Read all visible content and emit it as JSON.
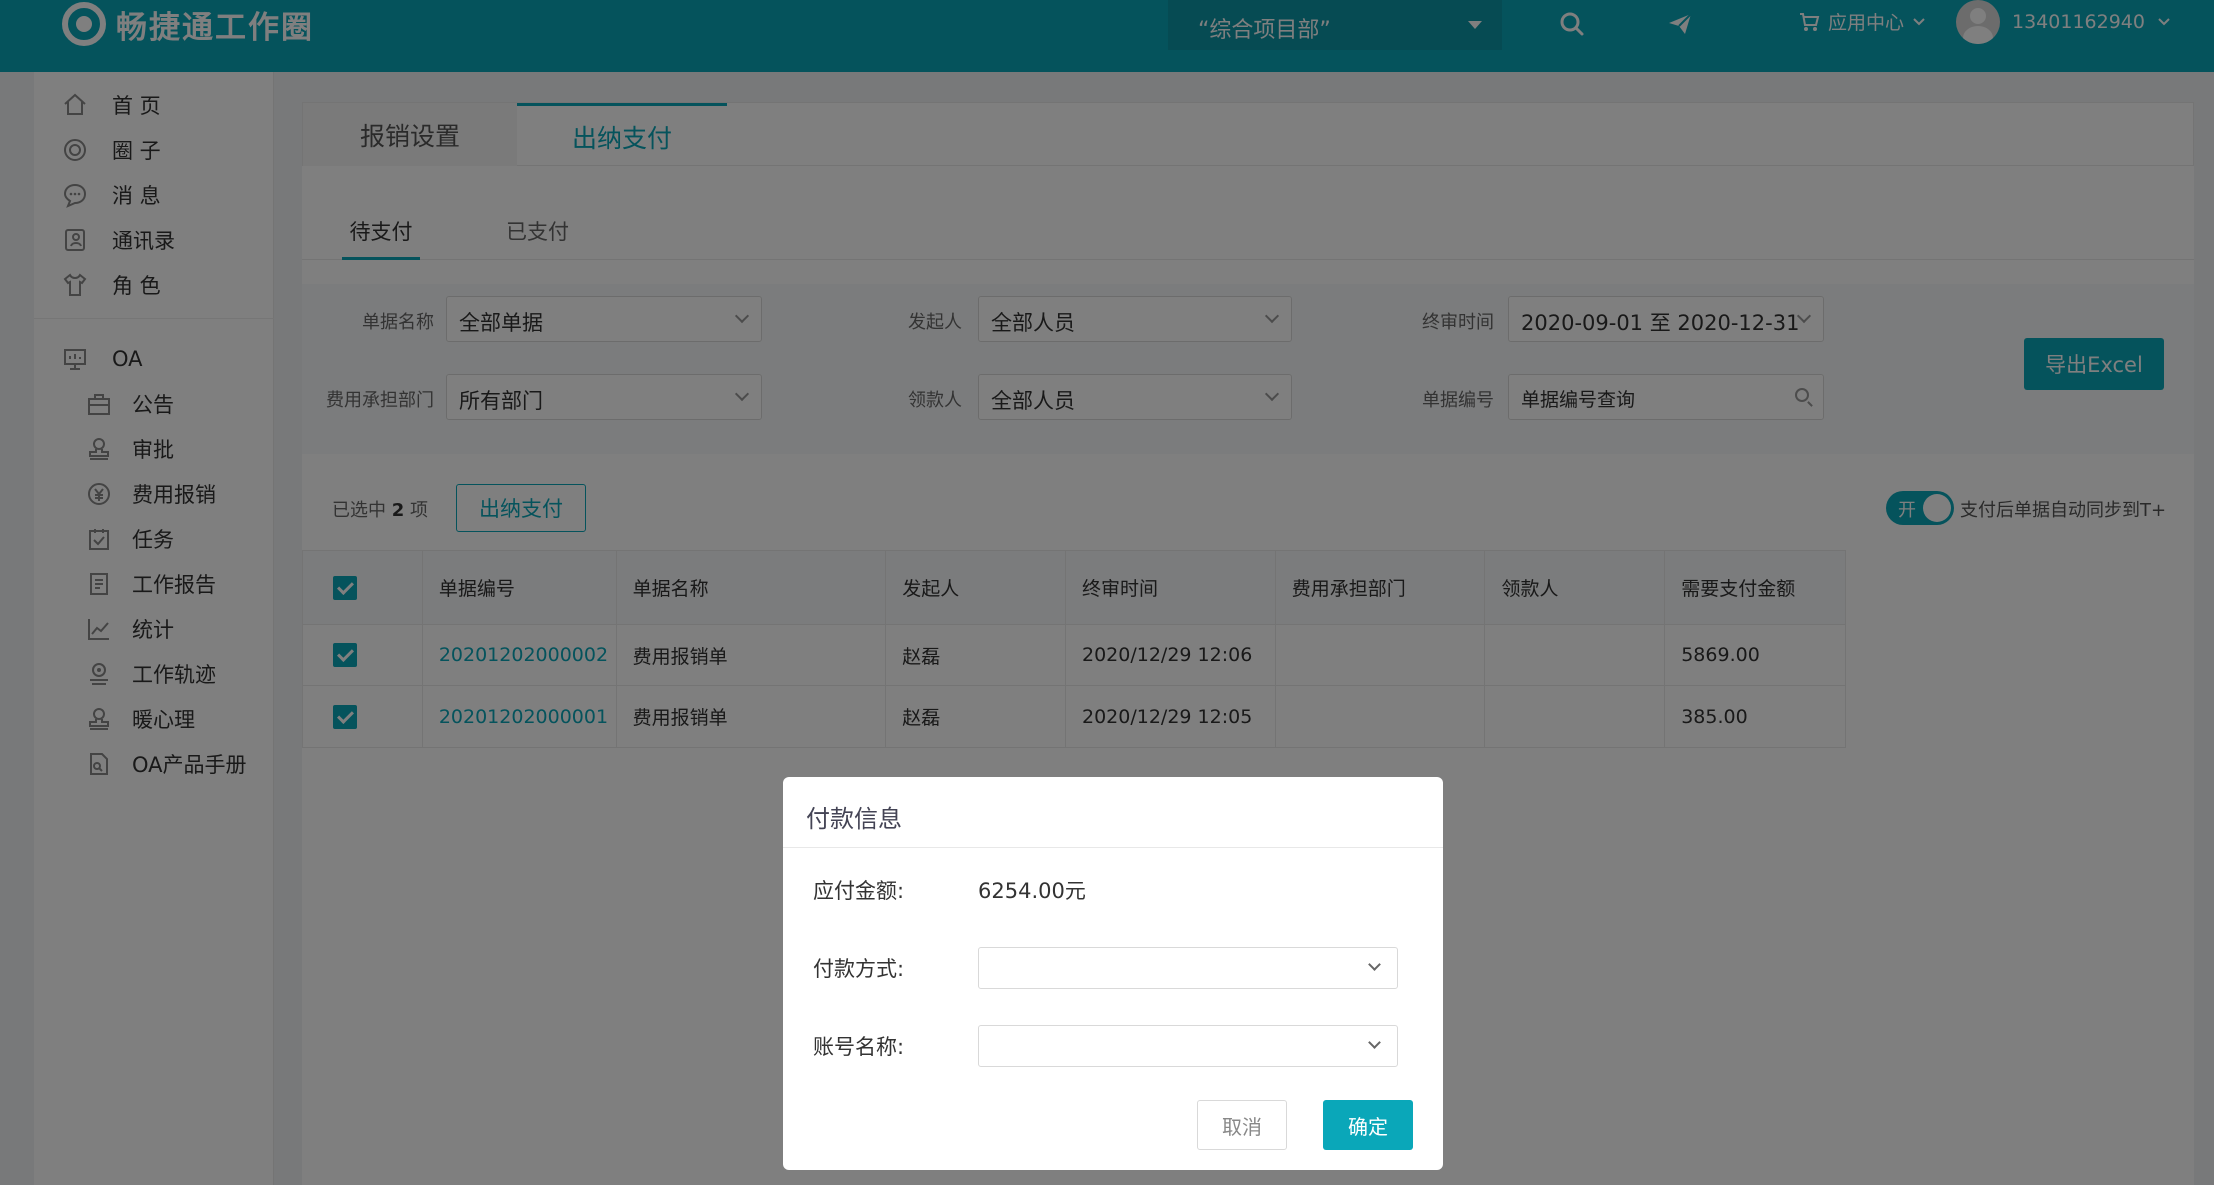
{
  "header": {
    "logo_text": "畅捷通工作圈",
    "project": "“综合项目部”",
    "app_center": "应用中心",
    "user_phone": "13401162940"
  },
  "sidebar": {
    "items": [
      {
        "label": "首 页",
        "icon": "home-icon"
      },
      {
        "label": "圈 子",
        "icon": "circle-icon"
      },
      {
        "label": "消 息",
        "icon": "message-icon"
      },
      {
        "label": "通讯录",
        "icon": "contacts-icon"
      },
      {
        "label": "角 色",
        "icon": "role-icon"
      }
    ],
    "oa_label": "OA",
    "oa_items": [
      {
        "label": "公告",
        "icon": "announcement-icon"
      },
      {
        "label": "审批",
        "icon": "approval-icon"
      },
      {
        "label": "费用报销",
        "icon": "reimbursement-icon"
      },
      {
        "label": "任务",
        "icon": "task-icon"
      },
      {
        "label": "工作报告",
        "icon": "report-icon"
      },
      {
        "label": "统计",
        "icon": "statistics-icon"
      },
      {
        "label": "工作轨迹",
        "icon": "track-icon"
      },
      {
        "label": "暖心理",
        "icon": "care-icon"
      },
      {
        "label": "OA产品手册",
        "icon": "manual-icon"
      }
    ]
  },
  "tabs": {
    "settings": "报销设置",
    "cashier": "出纳支付"
  },
  "subtabs": {
    "pending": "待支付",
    "paid": "已支付"
  },
  "filters": {
    "doc_name_label": "单据名称",
    "doc_name_value": "全部单据",
    "initiator_label": "发起人",
    "initiator_value": "全部人员",
    "final_time_label": "终审时间",
    "final_time_value": "2020-09-01 至 2020-12-31",
    "dept_label": "费用承担部门",
    "dept_value": "所有部门",
    "payee_label": "领款人",
    "payee_value": "全部人员",
    "doc_no_label": "单据编号",
    "doc_no_placeholder": "单据编号查询",
    "export_label": "导出Excel"
  },
  "selection": {
    "prefix": "已选中",
    "count": "2",
    "suffix": "项",
    "pay_button": "出纳支付",
    "toggle_label": "开",
    "toggle_text": "支付后单据自动同步到T+"
  },
  "table": {
    "headers": [
      "单据编号",
      "单据名称",
      "发起人",
      "终审时间",
      "费用承担部门",
      "领款人",
      "需要支付金额"
    ],
    "rows": [
      {
        "no": "20201202000002",
        "name": "费用报销单",
        "initiator": "赵磊",
        "time": "2020/12/29 12:06",
        "dept": "",
        "payee": "",
        "amount": "5869.00"
      },
      {
        "no": "20201202000001",
        "name": "费用报销单",
        "initiator": "赵磊",
        "time": "2020/12/29 12:05",
        "dept": "",
        "payee": "",
        "amount": "385.00"
      }
    ]
  },
  "modal": {
    "title": "付款信息",
    "amount_label": "应付金额:",
    "amount_value": "6254.00元",
    "method_label": "付款方式:",
    "account_label": "账号名称:",
    "cancel_label": "取消",
    "ok_label": "确定"
  },
  "colors": {
    "accent": "#0aa7b9"
  }
}
